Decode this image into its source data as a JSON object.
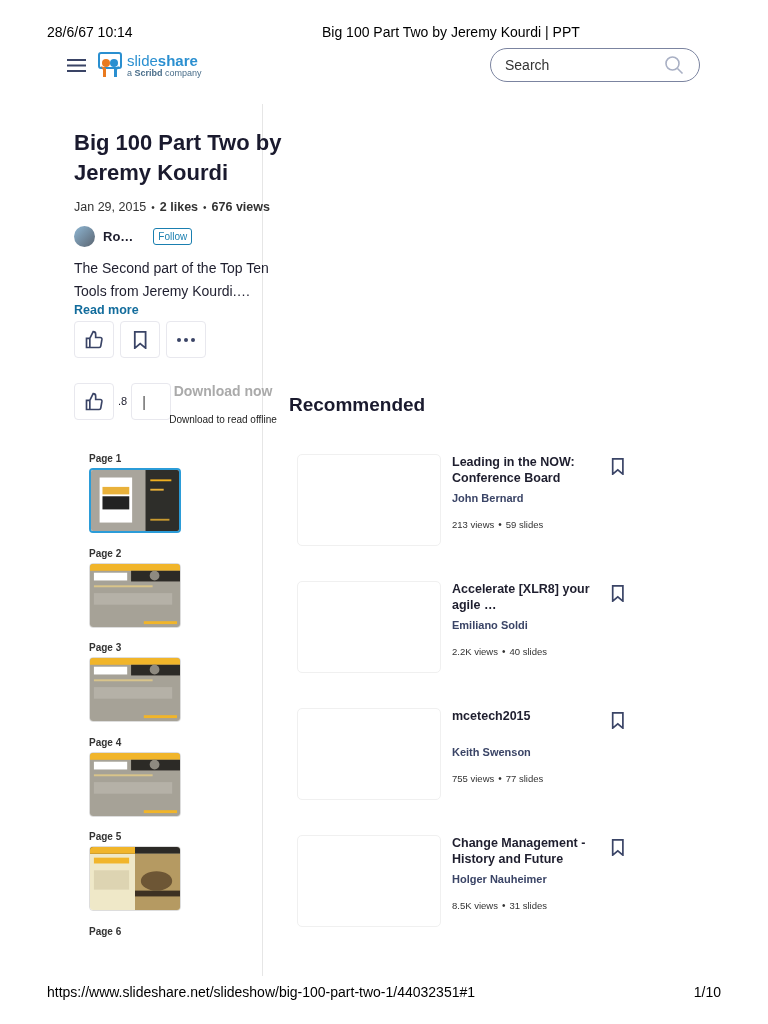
{
  "print_header": {
    "datetime": "28/6/67 10:14",
    "title": "Big 100 Part Two by Jeremy Kourdi | PPT"
  },
  "header": {
    "logo": {
      "name": "slide**share**",
      "tagline": "a **Scribd** company"
    },
    "search": {
      "placeholder": "Search"
    }
  },
  "document": {
    "title": "Big 100 Part Two by Jeremy Kourdi",
    "date": "Jan 29, 2015",
    "likes": "2 likes",
    "views": "676 views",
    "author": "Ro…",
    "follow": "Follow",
    "description": "The Second part of the Top Ten Tools from Jeremy Kourdi.…",
    "read_more": "Read more",
    "separators": [
      "•",
      "•"
    ]
  },
  "sticky_bar": {
    "count": ".8",
    "separator": "|",
    "download": "Download now",
    "download_hint": "Download to read offline"
  },
  "pages": [
    {
      "label": "Page 1",
      "kind": "thumbnail",
      "selected": true
    },
    {
      "label": "Page 2",
      "kind": "thumbnail",
      "selected": false
    },
    {
      "label": "Page 3",
      "kind": "thumbnail",
      "selected": false
    },
    {
      "label": "Page 4",
      "kind": "thumbnail",
      "selected": false
    },
    {
      "label": "Page 5",
      "kind": "thumbnail",
      "selected": false
    },
    {
      "label": "Page 6",
      "kind": "label",
      "selected": false
    }
  ],
  "recommended": {
    "title": "Recommended",
    "items": [
      {
        "title": "Leading in the NOW: Conference Board",
        "author": "John Bernard",
        "views": "213 views",
        "separator": "•",
        "slides": "59 slides"
      },
      {
        "title": "Accelerate [XLR8] your agile …",
        "author": "Emiliano Soldi",
        "views": "2.2K views",
        "separator": "•",
        "slides": "40 slides"
      },
      {
        "title": "mcetech2015",
        "author": "Keith Swenson",
        "views": "755 views",
        "separator": "•",
        "slides": "77 slides"
      },
      {
        "title": "Change Management - History and Future",
        "author": "Holger Nauheimer",
        "views": "8.5K views",
        "separator": "•",
        "slides": "31 slides"
      }
    ]
  },
  "footer": {
    "url": "https://www.slideshare.net/slideshow/big-100-part-two-1/44032351#1",
    "page": "1/10"
  }
}
